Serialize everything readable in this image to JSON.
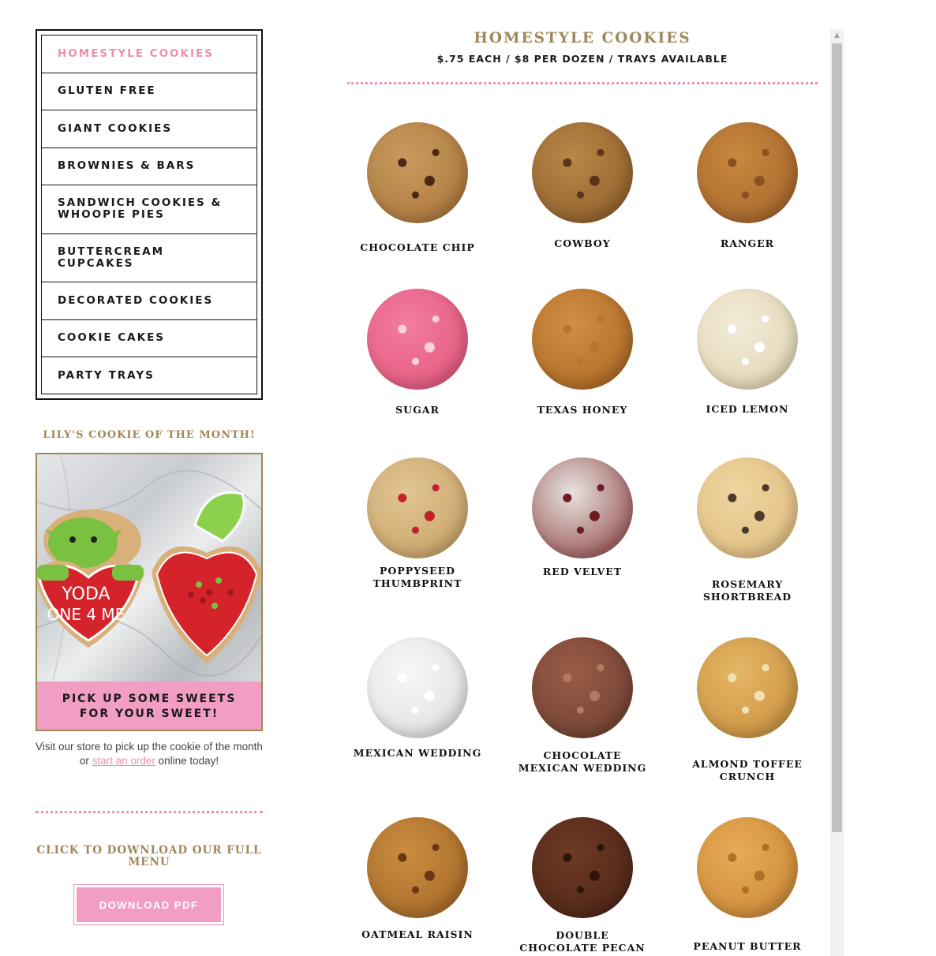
{
  "nav": {
    "items": [
      {
        "label": "HOMESTYLE COOKIES",
        "active": true
      },
      {
        "label": "GLUTEN FREE"
      },
      {
        "label": "GIANT COOKIES"
      },
      {
        "label": "BROWNIES & BARS"
      },
      {
        "label": "SANDWICH COOKIES & WHOOPIE PIES"
      },
      {
        "label": "BUTTERCREAM CUPCAKES"
      },
      {
        "label": "DECORATED COOKIES"
      },
      {
        "label": "COOKIE CAKES"
      },
      {
        "label": "PARTY TRAYS"
      }
    ]
  },
  "cookie_of_month": {
    "title": "LILY'S COOKIE OF THE MONTH!",
    "image_text_line1": "YODA",
    "image_text_line2": "ONE 4 ME",
    "caption": "PICK UP SOME SWEETS FOR YOUR SWEET!",
    "visit_before": "Visit our store to pick up the cookie of the month or ",
    "visit_link": "start an order",
    "visit_after": " online today!"
  },
  "download": {
    "title": "CLICK TO DOWNLOAD OUR FULL MENU",
    "button_label": "DOWNLOAD PDF"
  },
  "main": {
    "title": "HOMESTYLE COOKIES",
    "subtitle": "$.75 EACH / $8 PER DOZEN / TRAYS AVAILABLE",
    "cookies": [
      {
        "name": "CHOCOLATE CHIP",
        "colors": [
          "#c89a5e",
          "#a87338"
        ],
        "chips": "#4a2716"
      },
      {
        "name": "COWBOY",
        "colors": [
          "#b98747",
          "#8a5a28"
        ],
        "chips": "#5b3419"
      },
      {
        "name": "RANGER",
        "colors": [
          "#c9883f",
          "#a0612a"
        ],
        "chips": "#8b4f22"
      },
      {
        "name": "SUGAR",
        "colors": [
          "#f27ca0",
          "#e25478"
        ],
        "chips": "#fbd0dc"
      },
      {
        "name": "TEXAS HONEY",
        "colors": [
          "#d18f45",
          "#a8641f"
        ],
        "chips": "#b87530"
      },
      {
        "name": "ICED LEMON",
        "colors": [
          "#f3ebd8",
          "#ded2b0"
        ],
        "chips": "#ffffff"
      },
      {
        "name": "POPPYSEED THUMBPRINT",
        "colors": [
          "#e2c592",
          "#c49e63"
        ],
        "chips": "#c0222a"
      },
      {
        "name": "RED VELVET",
        "colors": [
          "#e7e3e0",
          "#8a3a3a"
        ],
        "chips": "#6e1c22"
      },
      {
        "name": "ROSEMARY SHORTBREAD",
        "colors": [
          "#f0d59f",
          "#ddba7d"
        ],
        "chips": "#4a3a2a"
      },
      {
        "name": "MEXICAN WEDDING",
        "colors": [
          "#f7f7f5",
          "#dcdcda"
        ],
        "chips": "#ffffff"
      },
      {
        "name": "CHOCOLATE MEXICAN WEDDING",
        "colors": [
          "#9a5c47",
          "#6b3d2f"
        ],
        "chips": "#b47a62"
      },
      {
        "name": "ALMOND TOFFEE CRUNCH",
        "colors": [
          "#e5b765",
          "#c48c3c"
        ],
        "chips": "#f3e2b5"
      },
      {
        "name": "OATMEAL RAISIN",
        "colors": [
          "#c98d40",
          "#a26425"
        ],
        "chips": "#6a3616"
      },
      {
        "name": "DOUBLE CHOCOLATE PECAN",
        "colors": [
          "#6e3a25",
          "#4a2314"
        ],
        "chips": "#2e150b"
      },
      {
        "name": "PEANUT BUTTER",
        "colors": [
          "#e8ab58",
          "#c88532"
        ],
        "chips": "#b06e26"
      }
    ]
  }
}
